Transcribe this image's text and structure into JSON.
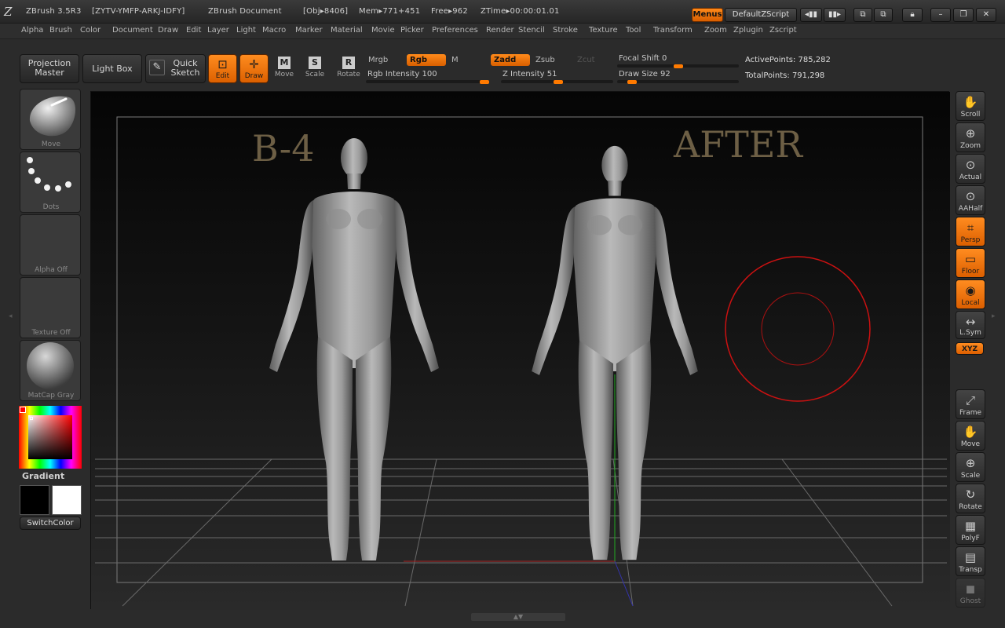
{
  "titlebar": {
    "app": "ZBrush 3.5R3",
    "serial": "[ZYTV-YMFP-ARKJ-IDFY]",
    "document": "ZBrush Document",
    "obj": "[Obj▸8406]",
    "mem": "Mem▸771+451",
    "free": "Free▸962",
    "ztime": "ZTime▸00:00:01.01",
    "menus_btn": "Menus",
    "script_btn": "DefaultZScript"
  },
  "menubar": {
    "items": [
      "Alpha",
      "Brush",
      "Color",
      "Document",
      "Draw",
      "Edit",
      "Layer",
      "Light",
      "Macro",
      "Marker",
      "Material",
      "Movie",
      "Picker",
      "Preferences",
      "Render",
      "Stencil",
      "Stroke",
      "Texture",
      "Tool",
      "Transform",
      "Zoom",
      "Zplugin",
      "Zscript"
    ]
  },
  "toolbar": {
    "projection_master": [
      "Projection",
      "Master"
    ],
    "lightbox": "Light Box",
    "quick_sketch": [
      "Quick",
      "Sketch"
    ],
    "edit": "Edit",
    "draw": "Draw",
    "move": "Move",
    "scale": "Scale",
    "rotate": "Rotate",
    "mrgb": "Mrgb",
    "rgb": "Rgb",
    "m": "M",
    "zadd": "Zadd",
    "zsub": "Zsub",
    "zcut": "Zcut",
    "rgb_intensity_label": "Rgb Intensity",
    "rgb_intensity": 100,
    "z_intensity_label": "Z Intensity",
    "z_intensity": 51,
    "focal_shift_label": "Focal Shift",
    "focal_shift": 0,
    "draw_size_label": "Draw Size",
    "draw_size": 92,
    "active_points": "ActivePoints: 785,282",
    "total_points": "TotalPoints: 791,298"
  },
  "leftpanel": {
    "brush_cap": "Move",
    "stroke_cap": "Dots",
    "alpha_cap": "Alpha  Off",
    "texture_cap": "Texture  Off",
    "material_cap": "MatCap  Gray",
    "gradient": "Gradient",
    "switchcolor": "SwitchColor"
  },
  "canvas": {
    "label_before": "B-4",
    "label_after": "AFTER"
  },
  "rightpanel": {
    "buttons": [
      "Scroll",
      "Zoom",
      "Actual",
      "AAHalf",
      "Persp",
      "Floor",
      "Local",
      "L.Sym",
      "XYZ",
      "Frame",
      "Move",
      "Scale",
      "Rotate",
      "PolyF",
      "Transp",
      "Ghost"
    ]
  },
  "colors": {
    "accent": "#ff7a00",
    "brush_ring": "#cc1111",
    "label_text": "#6d5f45"
  }
}
